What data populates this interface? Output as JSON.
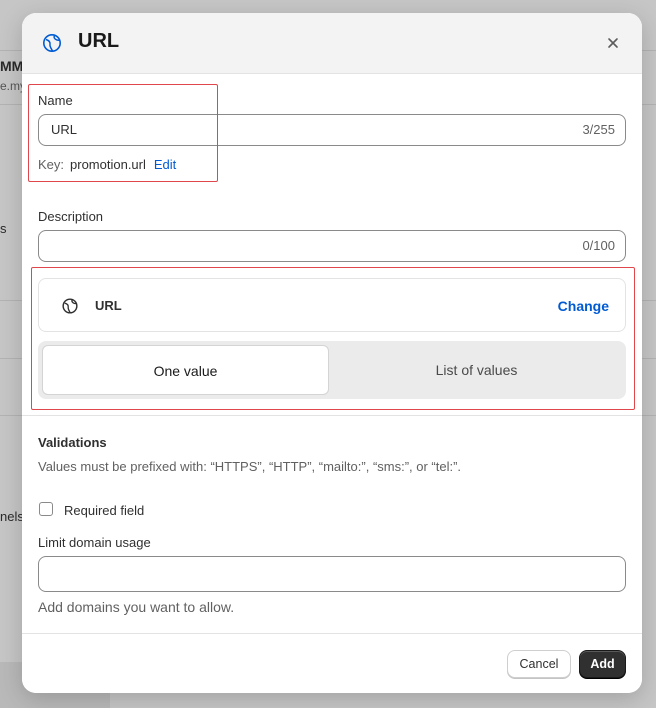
{
  "background": {
    "fragments": [
      "MM",
      "e.my",
      "s",
      "nels"
    ]
  },
  "modal": {
    "title": "URL",
    "header_icon": "globe-icon",
    "close_icon": "close-icon"
  },
  "name_field": {
    "label": "Name",
    "value": "URL",
    "char_count": "3/255",
    "key_label": "Key:",
    "key_value": "promotion.url",
    "edit_label": "Edit"
  },
  "description_field": {
    "label": "Description",
    "value": "",
    "char_count": "0/100"
  },
  "type_selector": {
    "icon": "globe-icon",
    "label": "URL",
    "change_label": "Change"
  },
  "value_mode": {
    "options": [
      "One value",
      "List of values"
    ],
    "selected": "One value"
  },
  "validations": {
    "heading": "Validations",
    "help": "Values must be prefixed with: “HTTPS”, “HTTP”, “mailto:”, “sms:”, or “tel:”.",
    "required_label": "Required field",
    "required_checked": false,
    "domain_label": "Limit domain usage",
    "domain_value": "",
    "domain_help": "Add domains you want to allow."
  },
  "footer": {
    "cancel_label": "Cancel",
    "add_label": "Add"
  },
  "colors": {
    "accent_link": "#005bd3",
    "primary_button": "#303030",
    "highlight": "#e0474c"
  }
}
